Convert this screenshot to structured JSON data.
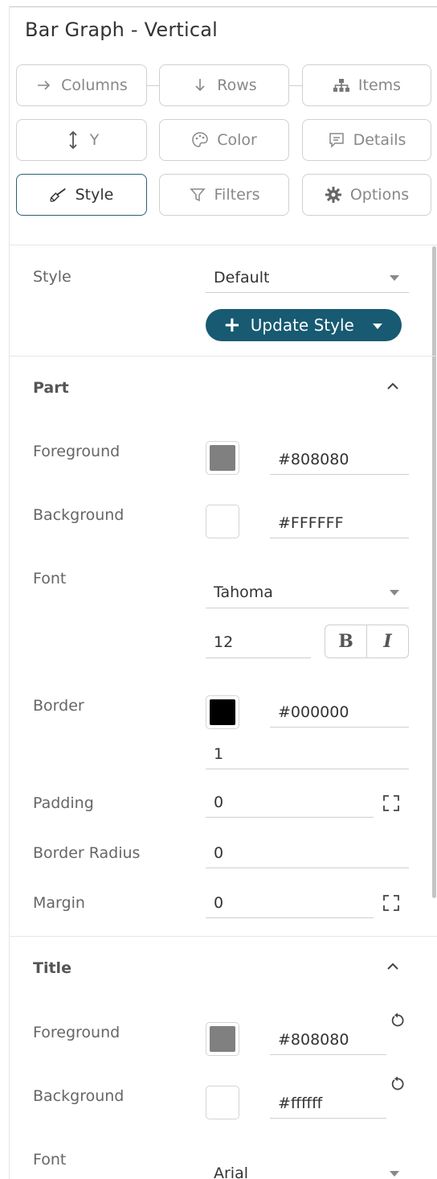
{
  "title": "Bar Graph - Vertical",
  "buttons": {
    "columns": "Columns",
    "rows": "Rows",
    "items": "Items",
    "y": "Y",
    "color": "Color",
    "details": "Details",
    "style": "Style",
    "filters": "Filters",
    "options": "Options"
  },
  "style_section": {
    "label": "Style",
    "value": "Default",
    "update_label": "Update Style"
  },
  "part": {
    "title": "Part",
    "foreground_label": "Foreground",
    "foreground_value": "#808080",
    "background_label": "Background",
    "background_value": "#FFFFFF",
    "font_label": "Font",
    "font_value": "Tahoma",
    "font_size": "12",
    "bold_label": "B",
    "italic_label": "I",
    "border_label": "Border",
    "border_value": "#000000",
    "border_width": "1",
    "padding_label": "Padding",
    "padding_value": "0",
    "radius_label": "Border Radius",
    "radius_value": "0",
    "margin_label": "Margin",
    "margin_value": "0"
  },
  "title_section": {
    "title": "Title",
    "foreground_label": "Foreground",
    "foreground_value": "#808080",
    "background_label": "Background",
    "background_value": "#ffffff",
    "font_label": "Font",
    "font_value": "Arial"
  },
  "colors": {
    "accent": "#175a72",
    "active_border": "#2b5f74",
    "gray_swatch": "#808080",
    "white_swatch": "#ffffff",
    "black_swatch": "#000000"
  }
}
